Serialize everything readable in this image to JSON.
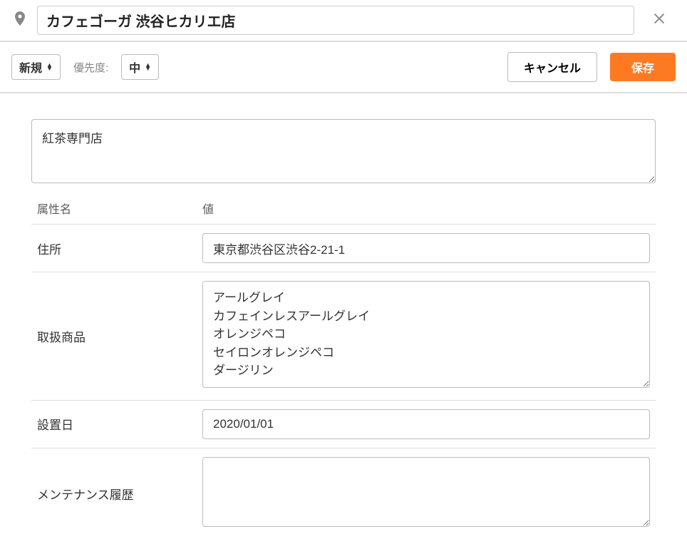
{
  "header": {
    "title": "カフェゴーガ 渋谷ヒカリエ店"
  },
  "toolbar": {
    "status_value": "新規",
    "priority_label": "優先度:",
    "priority_value": "中",
    "cancel_label": "キャンセル",
    "save_label": "保存"
  },
  "form": {
    "description": "紅茶専門店",
    "attr_header_name": "属性名",
    "attr_header_value": "値",
    "rows": [
      {
        "label": "住所",
        "value": "東京都渋谷区渋谷2-21-1",
        "type": "text"
      },
      {
        "label": "取扱商品",
        "value": "アールグレイ\nカフェインレスアールグレイ\nオレンジペコ\nセイロンオレンジペコ\nダージリン",
        "type": "textarea"
      },
      {
        "label": "設置日",
        "value": "2020/01/01",
        "type": "text"
      },
      {
        "label": "メンテナンス履歴",
        "value": "",
        "type": "textarea"
      }
    ]
  }
}
